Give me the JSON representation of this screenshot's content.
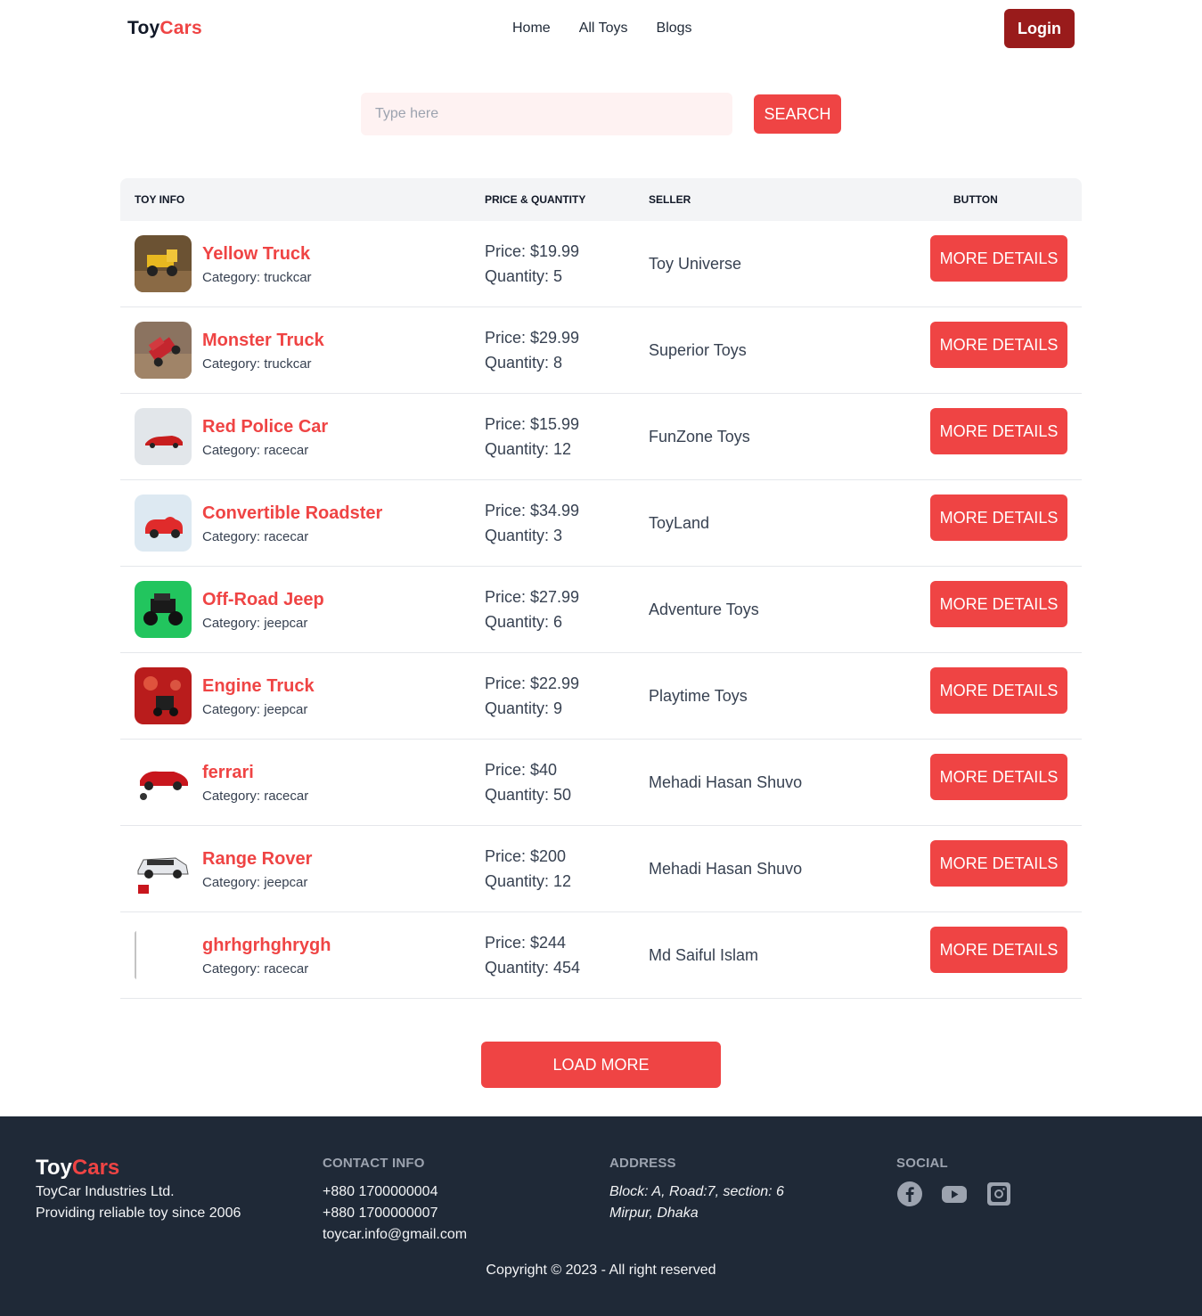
{
  "navbar": {
    "logo_part1": "Toy",
    "logo_part2": "Cars",
    "links": [
      "Home",
      "All Toys",
      "Blogs"
    ],
    "login_label": "Login"
  },
  "search": {
    "placeholder": "Type here",
    "button_label": "SEARCH"
  },
  "table": {
    "headers": [
      "TOY INFO",
      "PRICE & QUANTITY",
      "SELLER",
      "BUTTON"
    ],
    "button_label": "MORE DETAILS",
    "rows": [
      {
        "name": "Yellow Truck",
        "category": "Category: truckcar",
        "price": "Price: $19.99",
        "quantity": "Quantity: 5",
        "seller": "Toy Universe",
        "image": "yellow-truck"
      },
      {
        "name": "Monster Truck",
        "category": "Category: truckcar",
        "price": "Price: $29.99",
        "quantity": "Quantity: 8",
        "seller": "Superior Toys",
        "image": "monster-truck"
      },
      {
        "name": "Red Police Car",
        "category": "Category: racecar",
        "price": "Price: $15.99",
        "quantity": "Quantity: 12",
        "seller": "FunZone Toys",
        "image": "red-police-car"
      },
      {
        "name": "Convertible Roadster",
        "category": "Category: racecar",
        "price": "Price: $34.99",
        "quantity": "Quantity: 3",
        "seller": "ToyLand",
        "image": "convertible-roadster"
      },
      {
        "name": "Off-Road Jeep",
        "category": "Category: jeepcar",
        "price": "Price: $27.99",
        "quantity": "Quantity: 6",
        "seller": "Adventure Toys",
        "image": "off-road-jeep"
      },
      {
        "name": "Engine Truck",
        "category": "Category: jeepcar",
        "price": "Price: $22.99",
        "quantity": "Quantity: 9",
        "seller": "Playtime Toys",
        "image": "engine-truck"
      },
      {
        "name": "ferrari",
        "category": "Category: racecar",
        "price": "Price: $40",
        "quantity": "Quantity: 50",
        "seller": "Mehadi Hasan Shuvo",
        "image": "ferrari"
      },
      {
        "name": "Range Rover",
        "category": "Category: jeepcar",
        "price": "Price: $200",
        "quantity": "Quantity: 12",
        "seller": "Mehadi Hasan Shuvo",
        "image": "range-rover"
      },
      {
        "name": "ghrhgrhghrygh",
        "category": "Category: racecar",
        "price": "Price: $244",
        "quantity": "Quantity: 454",
        "seller": "Md Saiful Islam",
        "image": "broken-image"
      }
    ]
  },
  "load_more_label": "LOAD MORE",
  "footer": {
    "logo_part1": "Toy",
    "logo_part2": "Cars",
    "company": "ToyCar Industries Ltd.",
    "tagline": "Providing reliable toy since 2006",
    "contact_title": "CONTACT INFO",
    "phone1": "+880 1700000004",
    "phone2": "+880 1700000007",
    "email": "toycar.info@gmail.com",
    "address_title": "ADDRESS",
    "address_line1": "Block: A, Road:7, section: 6",
    "address_line2": "Mirpur, Dhaka",
    "social_title": "SOCIAL",
    "social_icons": [
      "facebook-icon",
      "youtube-icon",
      "instagram-icon"
    ],
    "copyright": "Copyright © 2023 - All right reserved"
  },
  "colors": {
    "accent": "#ef4444",
    "login_bg": "#991b1b",
    "footer_bg": "#1f2937",
    "search_bg": "#fef2f2",
    "header_bg": "#f3f4f6"
  }
}
